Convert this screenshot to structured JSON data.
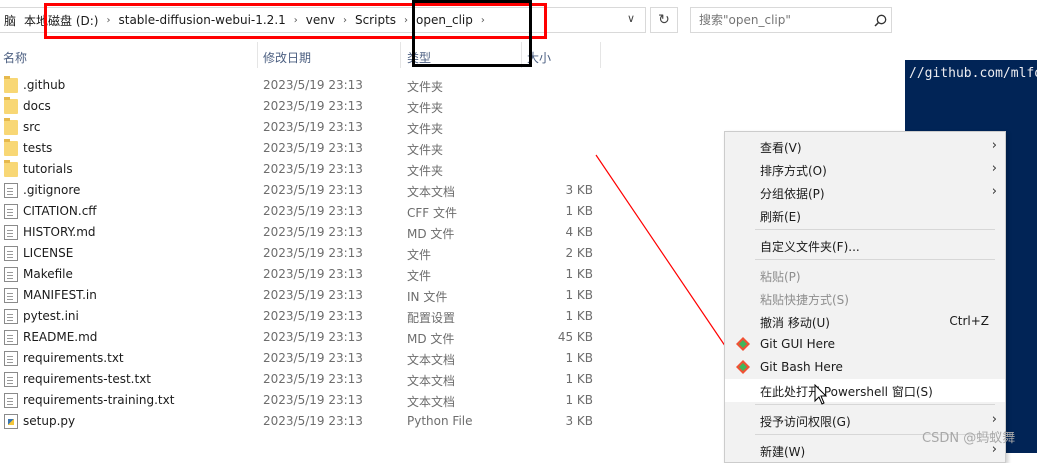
{
  "address_bar": {
    "crumbs": [
      "脑",
      "本地磁盘 (D:)",
      "stable-diffusion-webui-1.2.1",
      "venv",
      "Scripts",
      "open_clip"
    ],
    "search_placeholder": "搜索\"open_clip\""
  },
  "columns": {
    "name": "名称",
    "date": "修改日期",
    "type": "类型",
    "size": "大小"
  },
  "files": [
    {
      "name": ".github",
      "date": "2023/5/19 23:13",
      "type": "文件夹",
      "size": "",
      "icon": "folder-icon"
    },
    {
      "name": "docs",
      "date": "2023/5/19 23:13",
      "type": "文件夹",
      "size": "",
      "icon": "folder-icon"
    },
    {
      "name": "src",
      "date": "2023/5/19 23:13",
      "type": "文件夹",
      "size": "",
      "icon": "folder-icon"
    },
    {
      "name": "tests",
      "date": "2023/5/19 23:13",
      "type": "文件夹",
      "size": "",
      "icon": "folder-icon"
    },
    {
      "name": "tutorials",
      "date": "2023/5/19 23:13",
      "type": "文件夹",
      "size": "",
      "icon": "folder-icon"
    },
    {
      "name": ".gitignore",
      "date": "2023/5/19 23:13",
      "type": "文本文档",
      "size": "3 KB",
      "icon": "file-icon"
    },
    {
      "name": "CITATION.cff",
      "date": "2023/5/19 23:13",
      "type": "CFF 文件",
      "size": "1 KB",
      "icon": "file-icon"
    },
    {
      "name": "HISTORY.md",
      "date": "2023/5/19 23:13",
      "type": "MD 文件",
      "size": "4 KB",
      "icon": "file-icon"
    },
    {
      "name": "LICENSE",
      "date": "2023/5/19 23:13",
      "type": "文件",
      "size": "2 KB",
      "icon": "file-icon"
    },
    {
      "name": "Makefile",
      "date": "2023/5/19 23:13",
      "type": "文件",
      "size": "1 KB",
      "icon": "file-icon"
    },
    {
      "name": "MANIFEST.in",
      "date": "2023/5/19 23:13",
      "type": "IN 文件",
      "size": "1 KB",
      "icon": "file-icon"
    },
    {
      "name": "pytest.ini",
      "date": "2023/5/19 23:13",
      "type": "配置设置",
      "size": "1 KB",
      "icon": "file-icon"
    },
    {
      "name": "README.md",
      "date": "2023/5/19 23:13",
      "type": "MD 文件",
      "size": "45 KB",
      "icon": "file-icon"
    },
    {
      "name": "requirements.txt",
      "date": "2023/5/19 23:13",
      "type": "文本文档",
      "size": "1 KB",
      "icon": "file-icon"
    },
    {
      "name": "requirements-test.txt",
      "date": "2023/5/19 23:13",
      "type": "文本文档",
      "size": "1 KB",
      "icon": "file-icon"
    },
    {
      "name": "requirements-training.txt",
      "date": "2023/5/19 23:13",
      "type": "文本文档",
      "size": "1 KB",
      "icon": "file-icon"
    },
    {
      "name": "setup.py",
      "date": "2023/5/19 23:13",
      "type": "Python File",
      "size": "3 KB",
      "icon": "python-file-icon"
    }
  ],
  "context_menu": {
    "items": [
      {
        "label": "查看(V)",
        "submenu": true
      },
      {
        "label": "排序方式(O)",
        "submenu": true
      },
      {
        "label": "分组依据(P)",
        "submenu": true
      },
      {
        "label": "刷新(E)"
      },
      {
        "label": "自定义文件夹(F)..."
      },
      {
        "label": "粘贴(P)",
        "disabled": true
      },
      {
        "label": "粘贴快捷方式(S)",
        "disabled": true
      },
      {
        "label": "撤消 移动(U)",
        "shortcut": "Ctrl+Z"
      },
      {
        "label": "Git GUI Here",
        "icon": "git-icon"
      },
      {
        "label": "Git Bash Here",
        "icon": "git-icon"
      },
      {
        "label": "在此处打开 Powershell 窗口(S)",
        "highlighted": true
      },
      {
        "label": "授予访问权限(G)",
        "submenu": true
      },
      {
        "label": "新建(W)",
        "submenu": true
      }
    ]
  },
  "terminal": {
    "text": "//github.com/mlfo"
  },
  "watermark": "CSDN @蚂蚁舞",
  "colors": {
    "highlight_red": "#ff0000",
    "highlight_black": "#000000",
    "terminal_bg": "#012456",
    "arrow": "#ff0000"
  }
}
